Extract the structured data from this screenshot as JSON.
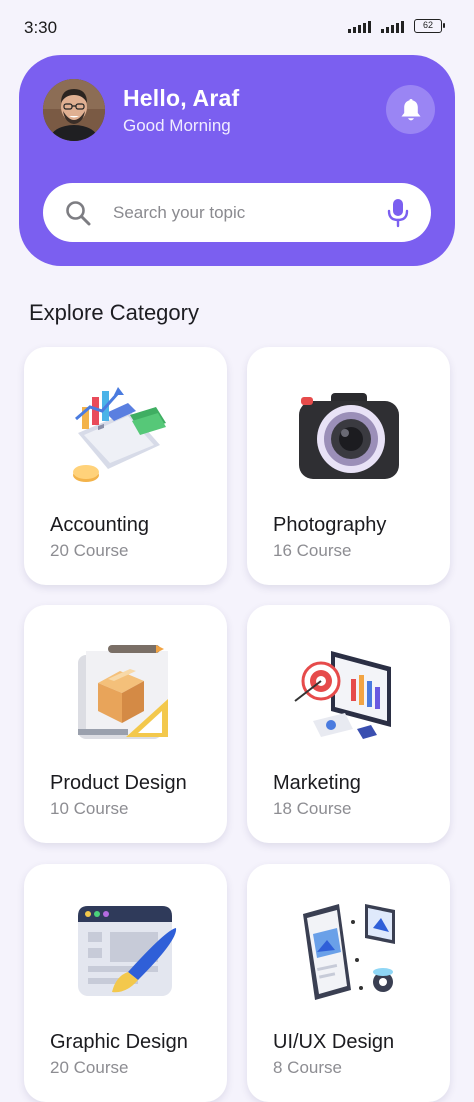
{
  "status_bar": {
    "time": "3:30",
    "battery": "62"
  },
  "header": {
    "greeting": "Hello, Araf",
    "subtitle": "Good Morning",
    "accent_color": "#7b5ff0"
  },
  "search": {
    "placeholder": "Search your topic"
  },
  "section": {
    "title": "Explore Category"
  },
  "categories": [
    {
      "title": "Accounting",
      "count": "20 Course",
      "icon": "accounting-illustration-icon"
    },
    {
      "title": "Photography",
      "count": "16 Course",
      "icon": "camera-icon"
    },
    {
      "title": "Product Design",
      "count": "10 Course",
      "icon": "product-box-icon"
    },
    {
      "title": "Marketing",
      "count": "18 Course",
      "icon": "marketing-target-icon"
    },
    {
      "title": "Graphic Design",
      "count": "20 Course",
      "icon": "graphic-brush-icon"
    },
    {
      "title": "UI/UX Design",
      "count": "8 Course",
      "icon": "ui-ux-phone-icon"
    }
  ]
}
